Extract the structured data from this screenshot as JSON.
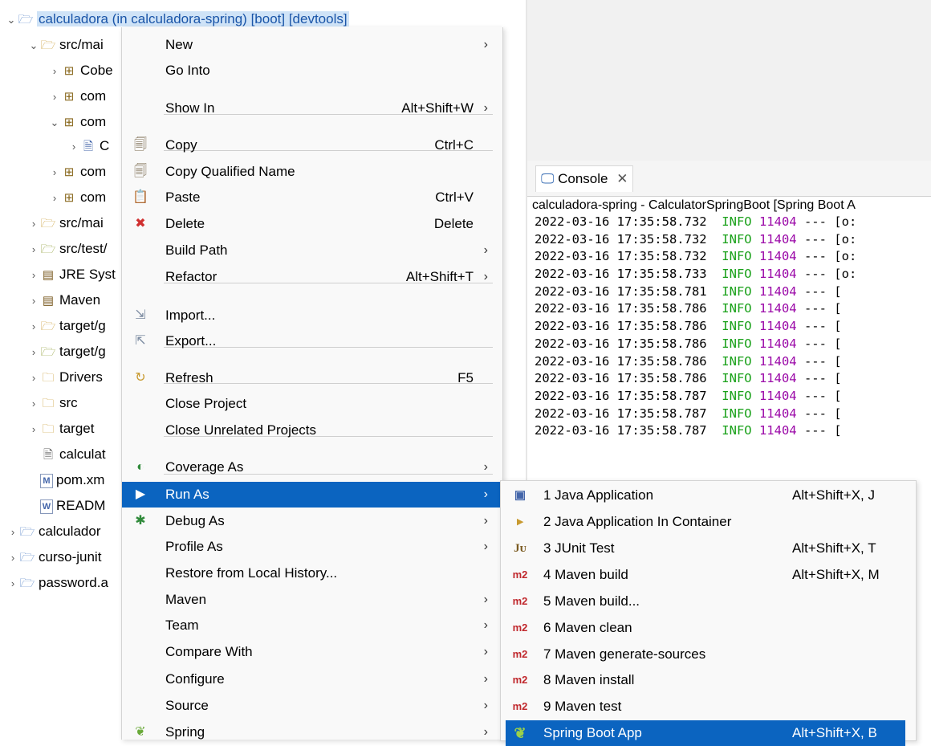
{
  "tree": {
    "rows": [
      {
        "chev": "⌄",
        "icon": "project-icon",
        "glyph": "🗀",
        "label": "calculadora (in calculadora-spring) [boot] [devtools]"
      },
      {
        "chev": "⌄",
        "icon": "source-folder-icon",
        "glyph": "📂",
        "label": "src/mai"
      },
      {
        "chev": "›",
        "icon": "package-icon",
        "glyph": "⊞",
        "label": "Cobe"
      },
      {
        "chev": "›",
        "icon": "package-icon",
        "glyph": "⊞",
        "label": "com"
      },
      {
        "chev": "⌄",
        "icon": "package-icon",
        "glyph": "⊞",
        "label": "com"
      },
      {
        "chev": "›",
        "icon": "java-file-icon",
        "glyph": "🗎",
        "label": "C"
      },
      {
        "chev": "›",
        "icon": "package-icon",
        "glyph": "⊞",
        "label": "com"
      },
      {
        "chev": "›",
        "icon": "package-icon",
        "glyph": "⊞",
        "label": "com"
      },
      {
        "chev": "›",
        "icon": "source-folder-icon",
        "glyph": "📂",
        "label": "src/mai"
      },
      {
        "chev": "›",
        "icon": "test-folder-icon",
        "glyph": "📂",
        "label": "src/test/"
      },
      {
        "chev": "›",
        "icon": "library-icon",
        "glyph": "▤",
        "label": "JRE Syst"
      },
      {
        "chev": "›",
        "icon": "library-icon",
        "glyph": "▤",
        "label": "Maven"
      },
      {
        "chev": "›",
        "icon": "generated-folder-icon",
        "glyph": "📂",
        "label": "target/g"
      },
      {
        "chev": "›",
        "icon": "generated-folder-icon",
        "glyph": "📂",
        "label": "target/g"
      },
      {
        "chev": "›",
        "icon": "folder-icon",
        "glyph": "📁",
        "label": "Drivers"
      },
      {
        "chev": "›",
        "icon": "folder-icon",
        "glyph": "📁",
        "label": "src"
      },
      {
        "chev": "›",
        "icon": "folder-icon",
        "glyph": "📁",
        "label": "target"
      },
      {
        "chev": "",
        "icon": "text-file-icon",
        "glyph": "🗎",
        "label": "calculat"
      },
      {
        "chev": "",
        "icon": "maven-pom-icon",
        "glyph": "M",
        "label": "pom.xm"
      },
      {
        "chev": "",
        "icon": "readme-file-icon",
        "glyph": "W",
        "label": "READM"
      },
      {
        "chev": "›",
        "icon": "project-icon",
        "glyph": "🗀",
        "label": "calculador"
      },
      {
        "chev": "›",
        "icon": "project-icon",
        "glyph": "🗀",
        "label": "curso-junit"
      },
      {
        "chev": "›",
        "icon": "project-icon",
        "glyph": "🗀",
        "label": "password.a"
      }
    ]
  },
  "console": {
    "tab_label": "Console",
    "header": "calculadora-spring - CalculatorSpringBoot [Spring Boot A",
    "lines": [
      {
        "ts": "2022-03-16 17:35:58.732",
        "level": "INFO",
        "pid": "11404",
        "rest": " --- [o:"
      },
      {
        "ts": "2022-03-16 17:35:58.732",
        "level": "INFO",
        "pid": "11404",
        "rest": " --- [o:"
      },
      {
        "ts": "2022-03-16 17:35:58.732",
        "level": "INFO",
        "pid": "11404",
        "rest": " --- [o:"
      },
      {
        "ts": "2022-03-16 17:35:58.733",
        "level": "INFO",
        "pid": "11404",
        "rest": " --- [o:"
      },
      {
        "ts": "2022-03-16 17:35:58.781",
        "level": "INFO",
        "pid": "11404",
        "rest": " --- ["
      },
      {
        "ts": "2022-03-16 17:35:58.786",
        "level": "INFO",
        "pid": "11404",
        "rest": " --- ["
      },
      {
        "ts": "2022-03-16 17:35:58.786",
        "level": "INFO",
        "pid": "11404",
        "rest": " --- ["
      },
      {
        "ts": "2022-03-16 17:35:58.786",
        "level": "INFO",
        "pid": "11404",
        "rest": " --- ["
      },
      {
        "ts": "2022-03-16 17:35:58.786",
        "level": "INFO",
        "pid": "11404",
        "rest": " --- ["
      },
      {
        "ts": "2022-03-16 17:35:58.786",
        "level": "INFO",
        "pid": "11404",
        "rest": " --- ["
      },
      {
        "ts": "2022-03-16 17:35:58.787",
        "level": "INFO",
        "pid": "11404",
        "rest": " --- ["
      },
      {
        "ts": "2022-03-16 17:35:58.787",
        "level": "INFO",
        "pid": "11404",
        "rest": " --- ["
      },
      {
        "ts": "2022-03-16 17:35:58.787",
        "level": "INFO",
        "pid": "11404",
        "rest": " --- ["
      }
    ]
  },
  "menu": {
    "items": [
      {
        "label": "New",
        "shortcut": "",
        "arrow": true,
        "icon": ""
      },
      {
        "label": "Go Into",
        "shortcut": "",
        "arrow": false,
        "icon": ""
      },
      {
        "label": "Show In",
        "shortcut": "Alt+Shift+W",
        "arrow": true,
        "icon": ""
      },
      {
        "label": "Copy",
        "shortcut": "Ctrl+C",
        "arrow": false,
        "icon": "copy-icon"
      },
      {
        "label": "Copy Qualified Name",
        "shortcut": "",
        "arrow": false,
        "icon": "copy-qualified-icon"
      },
      {
        "label": "Paste",
        "shortcut": "Ctrl+V",
        "arrow": false,
        "icon": "paste-icon"
      },
      {
        "label": "Delete",
        "shortcut": "Delete",
        "arrow": false,
        "icon": "delete-icon"
      },
      {
        "label": "Build Path",
        "shortcut": "",
        "arrow": true,
        "icon": ""
      },
      {
        "label": "Refactor",
        "shortcut": "Alt+Shift+T",
        "arrow": true,
        "icon": ""
      },
      {
        "label": "Import...",
        "shortcut": "",
        "arrow": false,
        "icon": "import-icon"
      },
      {
        "label": "Export...",
        "shortcut": "",
        "arrow": false,
        "icon": "export-icon"
      },
      {
        "label": "Refresh",
        "shortcut": "F5",
        "arrow": false,
        "icon": "refresh-icon"
      },
      {
        "label": "Close Project",
        "shortcut": "",
        "arrow": false,
        "icon": ""
      },
      {
        "label": "Close Unrelated Projects",
        "shortcut": "",
        "arrow": false,
        "icon": ""
      },
      {
        "label": "Coverage As",
        "shortcut": "",
        "arrow": true,
        "icon": "coverage-icon"
      },
      {
        "label": "Run As",
        "shortcut": "",
        "arrow": true,
        "icon": "run-icon"
      },
      {
        "label": "Debug As",
        "shortcut": "",
        "arrow": true,
        "icon": "debug-icon"
      },
      {
        "label": "Profile As",
        "shortcut": "",
        "arrow": true,
        "icon": ""
      },
      {
        "label": "Restore from Local History...",
        "shortcut": "",
        "arrow": false,
        "icon": ""
      },
      {
        "label": "Maven",
        "shortcut": "",
        "arrow": true,
        "icon": ""
      },
      {
        "label": "Team",
        "shortcut": "",
        "arrow": true,
        "icon": ""
      },
      {
        "label": "Compare With",
        "shortcut": "",
        "arrow": true,
        "icon": ""
      },
      {
        "label": "Configure",
        "shortcut": "",
        "arrow": true,
        "icon": ""
      },
      {
        "label": "Source",
        "shortcut": "",
        "arrow": true,
        "icon": ""
      },
      {
        "label": "Spring",
        "shortcut": "",
        "arrow": true,
        "icon": "spring-icon"
      }
    ]
  },
  "submenu": {
    "items": [
      {
        "label": "1 Java Application",
        "shortcut": "Alt+Shift+X, J",
        "icon": "java-application-icon",
        "glyph": "▣"
      },
      {
        "label": "2 Java Application In Container",
        "shortcut": "",
        "icon": "container-icon",
        "glyph": "▸"
      },
      {
        "label": "3 JUnit Test",
        "shortcut": "Alt+Shift+X, T",
        "icon": "junit-icon",
        "glyph": "Jᴜ"
      },
      {
        "label": "4 Maven build",
        "shortcut": "Alt+Shift+X, M",
        "icon": "maven-icon",
        "glyph": "m2"
      },
      {
        "label": "5 Maven build...",
        "shortcut": "",
        "icon": "maven-icon",
        "glyph": "m2"
      },
      {
        "label": "6 Maven clean",
        "shortcut": "",
        "icon": "maven-icon",
        "glyph": "m2"
      },
      {
        "label": "7 Maven generate-sources",
        "shortcut": "",
        "icon": "maven-icon",
        "glyph": "m2"
      },
      {
        "label": "8 Maven install",
        "shortcut": "",
        "icon": "maven-icon",
        "glyph": "m2"
      },
      {
        "label": "9 Maven test",
        "shortcut": "",
        "icon": "maven-icon",
        "glyph": "m2"
      },
      {
        "label": "Spring Boot App",
        "shortcut": "Alt+Shift+X, B",
        "icon": "spring-boot-icon",
        "glyph": "❦"
      }
    ]
  }
}
